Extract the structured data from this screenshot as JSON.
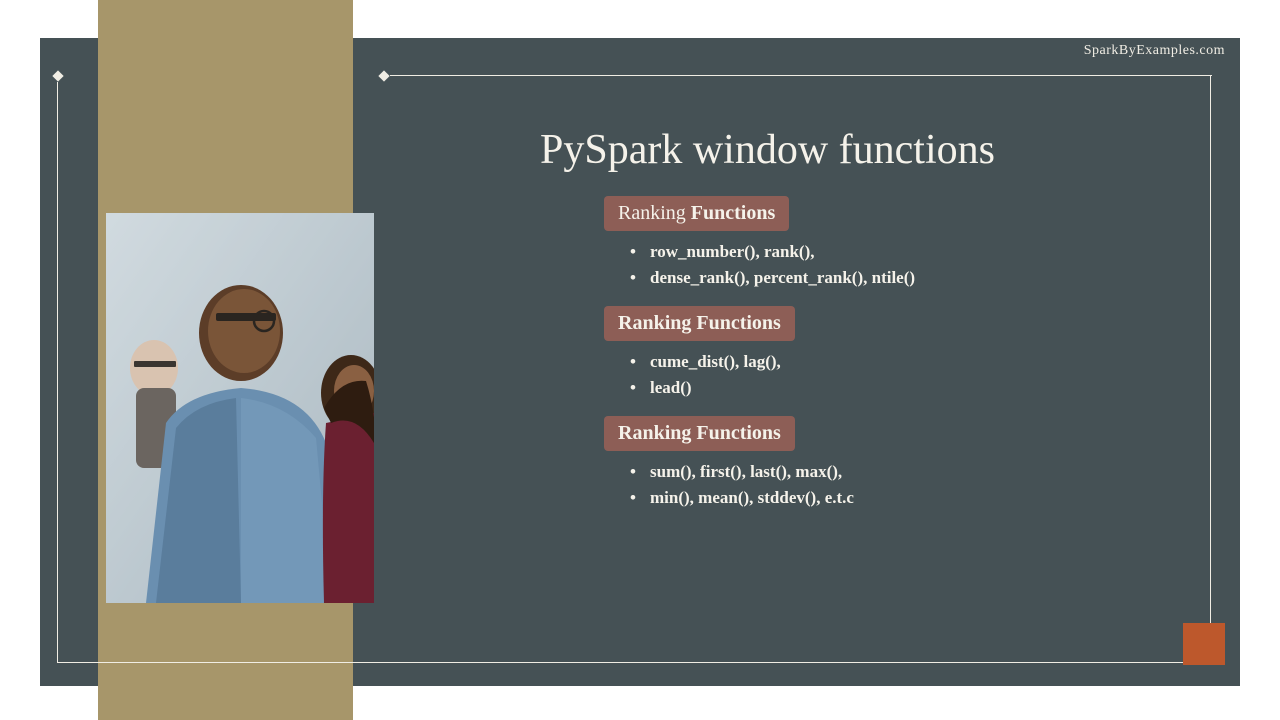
{
  "header": {
    "site": "SparkByExamples.com"
  },
  "title": "PySpark window functions",
  "sections": [
    {
      "heading_prefix": "Ranking ",
      "heading_bold": "Functions",
      "items": [
        "row_number(), rank(),",
        "dense_rank(), percent_rank(), ntile()"
      ]
    },
    {
      "heading_prefix": "",
      "heading_bold": "Ranking Functions",
      "items": [
        "cume_dist(), lag(),",
        "lead()"
      ]
    },
    {
      "heading_prefix": "",
      "heading_bold": "Ranking Functions",
      "items": [
        "sum(), first(), last(), max(),",
        "min(), mean(), stddev(), e.t.c"
      ]
    }
  ]
}
